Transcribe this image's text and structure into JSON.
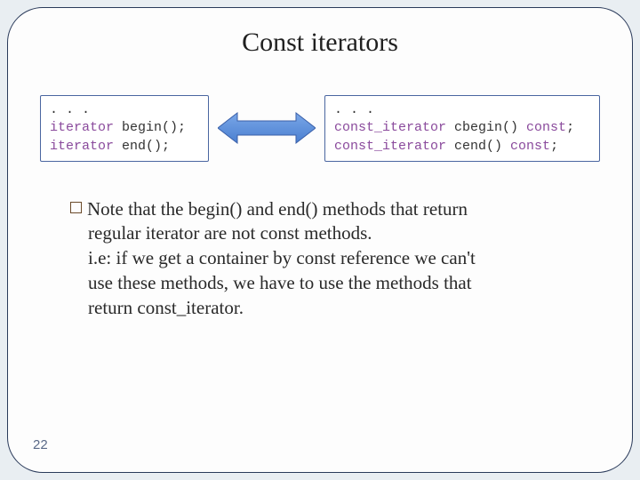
{
  "title": "Const iterators",
  "leftBox": {
    "l1": ". . .",
    "l2_a": "iterator",
    "l2_b": " begin();",
    "l3_a": "iterator",
    "l3_b": " end();"
  },
  "rightBox": {
    "l1": ". . .",
    "l2_a": "const_iterator",
    "l2_b": " cbegin() ",
    "l2_c": "const",
    "l2_d": ";",
    "l3_a": "const_iterator",
    "l3_b": " cend() ",
    "l3_c": "const",
    "l3_d": ";"
  },
  "note": {
    "line1": "Note that the begin() and end() methods that return",
    "line2": "regular iterator are not const methods.",
    "line3": "i.e: if we get a container by const reference we can't",
    "line4": "use these methods, we have to use the methods that",
    "line5": "return const_iterator."
  },
  "pageNumber": "22"
}
